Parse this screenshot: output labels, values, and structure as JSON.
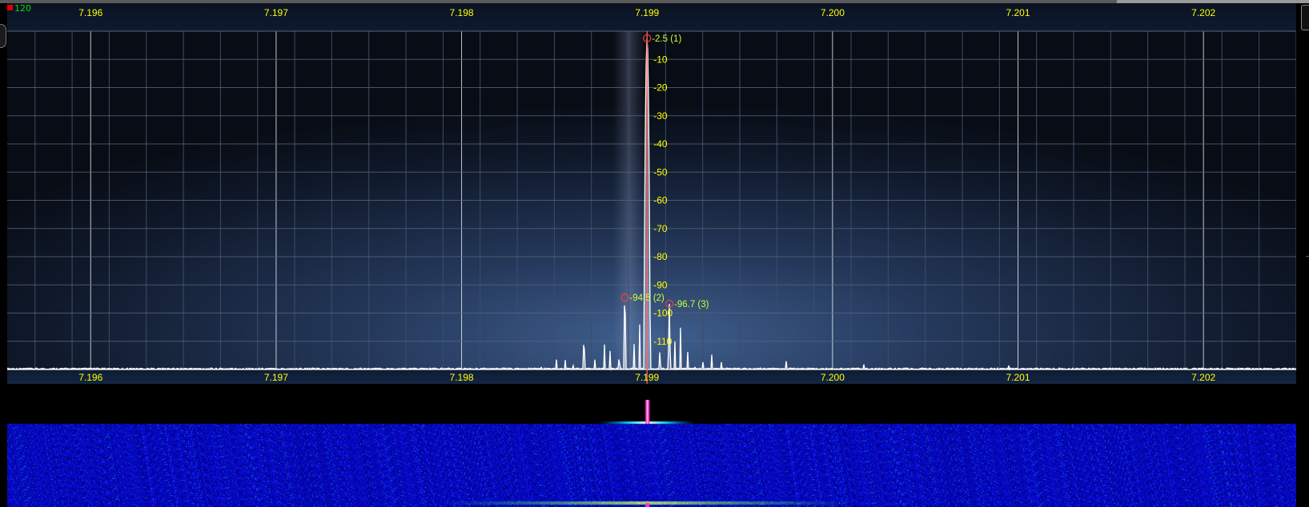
{
  "spectrum": {
    "max_db_label": "120",
    "freq_axis": {
      "labels": [
        "7.196",
        "7.197",
        "7.198",
        "7.199",
        "7.200",
        "7.201",
        "7.202"
      ],
      "values": [
        7.196,
        7.197,
        7.198,
        7.199,
        7.2,
        7.201,
        7.202
      ],
      "range": [
        7.19555,
        7.2025
      ]
    },
    "db_axis": {
      "labels": [
        "-10",
        "-20",
        "-30",
        "-40",
        "-50",
        "-60",
        "-70",
        "-80",
        "-90",
        "-100",
        "-110"
      ],
      "values": [
        -10,
        -20,
        -30,
        -40,
        -50,
        -60,
        -70,
        -80,
        -90,
        -100,
        -110
      ],
      "range": [
        0,
        -120
      ]
    },
    "markers": [
      {
        "label": "-2.5 (1)",
        "freq": 7.199,
        "db": -2.5
      },
      {
        "label": "-94.5 (2)",
        "freq": 7.19888,
        "db": -94.5
      },
      {
        "label": "-96.7 (3)",
        "freq": 7.19912,
        "db": -96.7
      }
    ],
    "center_freq": 7.199,
    "colors": {
      "grid_major": "#ffffff",
      "grid_minor": "#3d4d66",
      "axis_text": "#ffff00",
      "marker_text": "#ccff33",
      "marker_circle": "#ff3b3b",
      "trace": "#ffffff",
      "center_line": "#ff5a5a"
    }
  },
  "waterfall": {
    "center_freq": 7.199,
    "colors": {
      "noise": "#0000cc",
      "center_line": "#ff33cc"
    }
  }
}
